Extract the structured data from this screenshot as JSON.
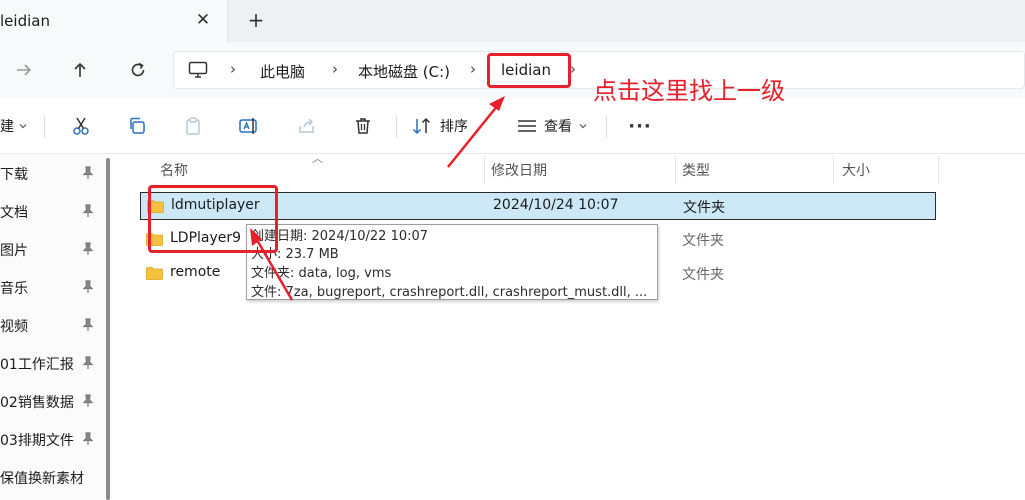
{
  "tab": {
    "title": "leidian",
    "close_glyph": "✕",
    "new_tab_glyph": "+"
  },
  "nav": {
    "forward_icon": "arrow-right-icon",
    "up_icon": "arrow-up-icon",
    "refresh_icon": "refresh-icon"
  },
  "address": {
    "device_icon": "monitor-icon",
    "crumbs": [
      "此电脑",
      "本地磁盘 (C:)",
      "leidian"
    ],
    "separator": "›"
  },
  "toolbar": {
    "new_label": "建",
    "sort_label": "排序",
    "view_label": "查看",
    "more_label": "···"
  },
  "sidebar": {
    "items": [
      {
        "label": "下载"
      },
      {
        "label": "文档"
      },
      {
        "label": "图片"
      },
      {
        "label": "音乐"
      },
      {
        "label": "视频"
      },
      {
        "label": "01工作汇报"
      },
      {
        "label": "02销售数据"
      },
      {
        "label": "03排期文件"
      },
      {
        "label": "保值换新素材"
      }
    ]
  },
  "columns": {
    "name": "名称",
    "modified": "修改日期",
    "type": "类型",
    "size": "大小"
  },
  "rows": [
    {
      "name": "ldmutiplayer",
      "modified": "2024/10/24 10:07",
      "type": "文件夹",
      "selected": true
    },
    {
      "name": "LDPlayer9",
      "modified": "",
      "type": "文件夹",
      "selected": false
    },
    {
      "name": "remote",
      "modified": "",
      "type": "文件夹",
      "selected": false
    }
  ],
  "tooltip": {
    "lines": [
      "创建日期: 2024/10/22 10:07",
      "大小: 23.7 MB",
      "文件夹: data, log, vms",
      "文件: 7za, bugreport, crashreport.dll, crashreport_must.dll, ..."
    ]
  },
  "annotation": {
    "text": "点击这里找上一级",
    "color": "#e8202c"
  },
  "colors": {
    "selection": "#cce8f7",
    "folder": "#f5c13f",
    "accent": "#e8202c"
  }
}
